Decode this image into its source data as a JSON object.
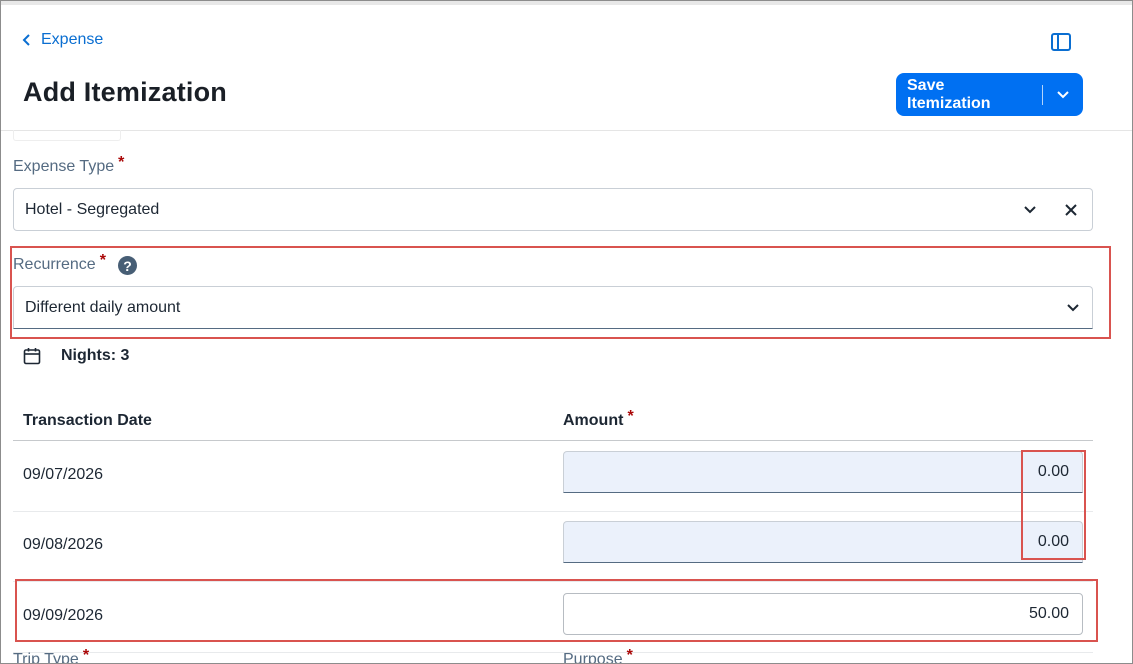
{
  "header": {
    "back_label": "Expense",
    "title": "Add Itemization",
    "save_label": "Save Itemization"
  },
  "expense_type": {
    "label": "Expense Type",
    "required": "*",
    "value": "Hotel - Segregated"
  },
  "recurrence": {
    "label": "Recurrence",
    "required": "*",
    "value": "Different daily amount"
  },
  "nights": {
    "text": "Nights: 3"
  },
  "table": {
    "date_header": "Transaction Date",
    "amount_header": "Amount",
    "amount_required": "*",
    "rows": [
      {
        "date": "09/07/2026",
        "amount": "0.00"
      },
      {
        "date": "09/08/2026",
        "amount": "0.00"
      },
      {
        "date": "09/09/2026",
        "amount": "50.00"
      }
    ]
  },
  "below": {
    "trip_type_label": "Trip Type",
    "purpose_label": "Purpose",
    "required": "*"
  },
  "colors": {
    "accent": "#0070f2",
    "link": "#0a6ed1",
    "required": "#aa0808",
    "highlight": "#d9534f",
    "readonly_field": "#ebf1fb"
  },
  "icons": [
    "chevron-left-icon",
    "side-panel-icon",
    "chevron-down-icon",
    "close-icon",
    "help-icon",
    "calendar-icon"
  ]
}
